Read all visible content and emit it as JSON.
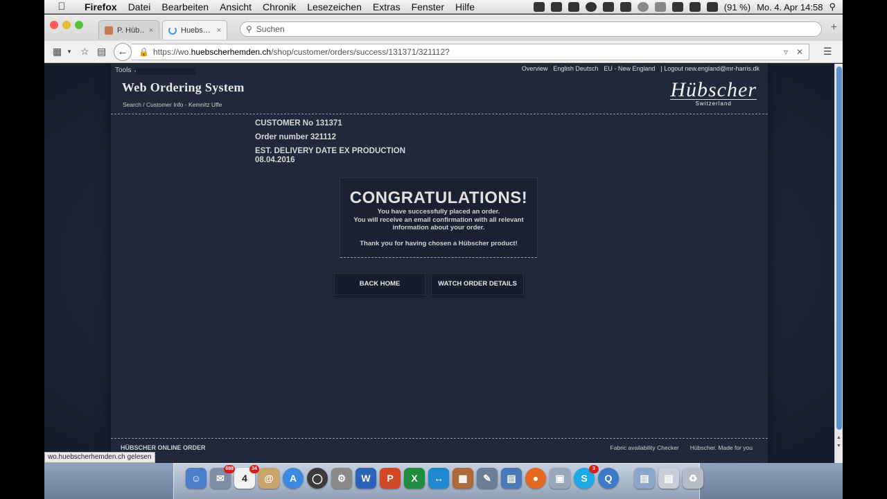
{
  "menubar": {
    "app": "Firefox",
    "items": [
      "Datei",
      "Bearbeiten",
      "Ansicht",
      "Chronik",
      "Lesezeichen",
      "Extras",
      "Fenster",
      "Hilfe"
    ],
    "battery": "(91 %)",
    "clock": "Mo. 4. Apr  14:58"
  },
  "tabs": [
    {
      "label": "P. Hüb…",
      "close": "×"
    },
    {
      "label": "Huebs…",
      "close": "×"
    }
  ],
  "browser": {
    "search_placeholder": "Suchen",
    "url_prefix": "https://wo.",
    "url_host": "huebscherhemden.ch",
    "url_path": "/shop/customer/orders/success/131371/321112?"
  },
  "page": {
    "tools": "Tools",
    "topnav": [
      "Overview",
      "English Deutsch",
      "EU - New England",
      "|  Logout new.england@mr-harris.dk"
    ],
    "title": "Web Ordering System",
    "subnav": "Search / Customer Info - Kemnitz Uffe",
    "logo": {
      "script": "Hübscher",
      "sub": "Switzerland"
    },
    "customer_no": "CUSTOMER No 131371",
    "order_number": "Order number 321112",
    "delivery_label": "EST. DELIVERY DATE EX PRODUCTION",
    "delivery_date": "08.04.2016",
    "congrats": {
      "title": "CONGRATULATIONS!",
      "line1": "You have successfully placed an order.",
      "line2": "You will receive an email confirmation with all relevant",
      "line3": "information about your order.",
      "line4": "Thank you for having chosen a Hübscher product!"
    },
    "buttons": {
      "back_home": "BACK HOME",
      "order_details": "WATCH ORDER DETAILS"
    },
    "footer_left": "HÜBSCHER ONLINE ORDER",
    "footer_right": [
      "Fabric availability Checker",
      "Hübscher. Made for you"
    ]
  },
  "status_tip": "wo.huebscherhemden.ch gelesen",
  "dock": {
    "mail_badge": "688",
    "calendar_day": "4",
    "calendar_badge": "34",
    "skype_badge": "3"
  },
  "colors": {
    "page_bg": "#1f2838",
    "accent_blue": "#5a8fd6"
  }
}
